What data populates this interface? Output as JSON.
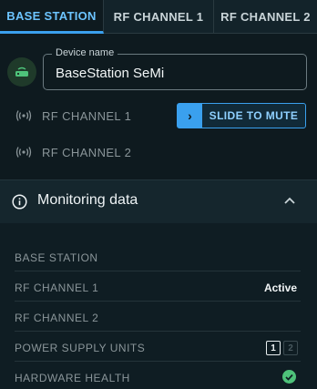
{
  "tabs": [
    {
      "label": "BASE STATION",
      "active": true
    },
    {
      "label": "RF CHANNEL 1",
      "active": false
    },
    {
      "label": "RF CHANNEL 2",
      "active": false
    }
  ],
  "device": {
    "field_label": "Device name",
    "value": "BaseStation SeMi",
    "icon": "router-icon"
  },
  "channels": [
    {
      "label": "RF CHANNEL 1",
      "icon": "wireless-icon",
      "button": "SLIDE TO MUTE"
    },
    {
      "label": "RF CHANNEL 2",
      "icon": "wireless-icon"
    }
  ],
  "monitoring": {
    "title": "Monitoring data",
    "rows": [
      {
        "label": "BASE STATION",
        "value": ""
      },
      {
        "label": "RF CHANNEL 1",
        "value": "Active"
      },
      {
        "label": "RF CHANNEL 2",
        "value": ""
      },
      {
        "label": "POWER SUPPLY UNITS",
        "psu": [
          "1",
          "2"
        ]
      },
      {
        "label": "HARDWARE HEALTH",
        "status": "ok"
      }
    ]
  },
  "colors": {
    "accent": "#3aa0ee",
    "ok": "#4ec27a",
    "background": "#0e1a1f"
  }
}
